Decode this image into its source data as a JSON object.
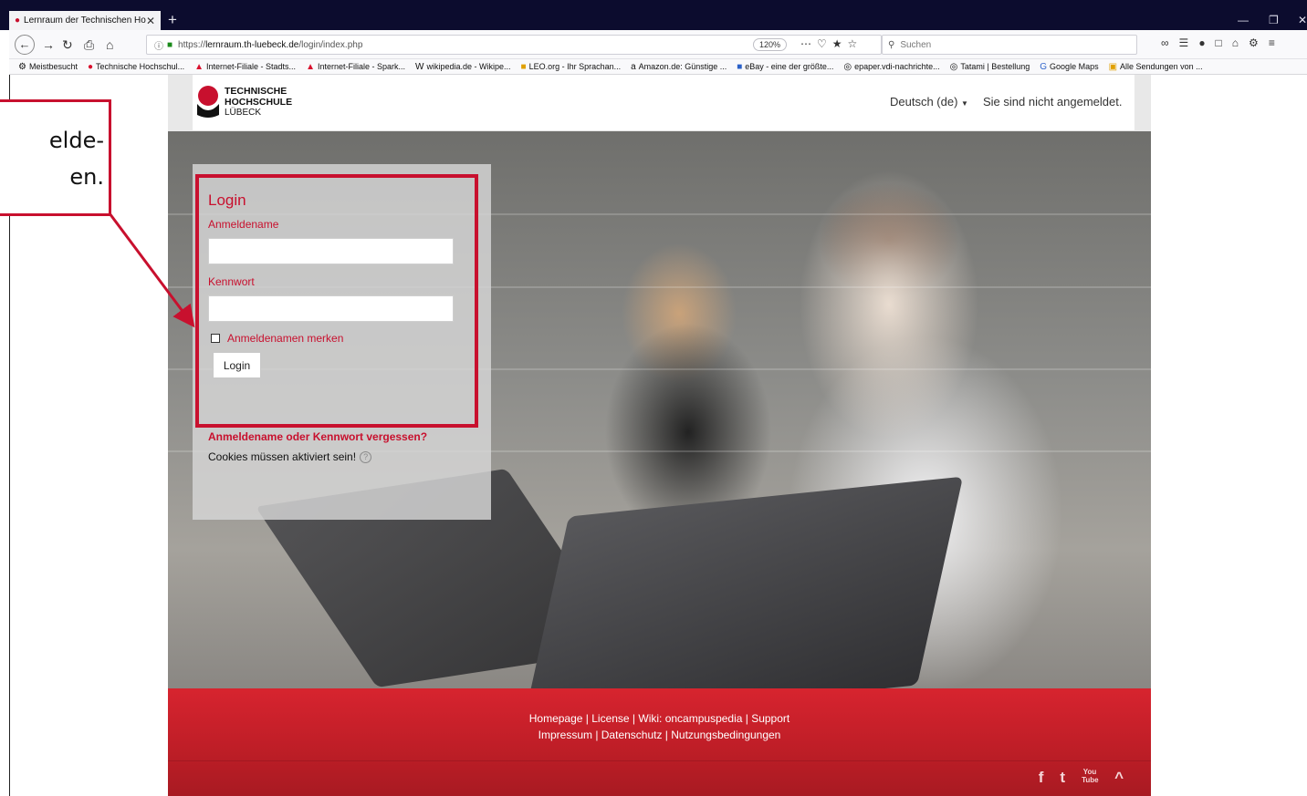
{
  "browser": {
    "tab_title": "Lernraum der Technischen Ho",
    "url_prefix": "https://",
    "url_host": "lernraum.th-luebeck.de",
    "url_path": "/login/index.php",
    "zoom": "120%",
    "search_placeholder": "Suchen",
    "bookmarks": [
      "Meistbesucht",
      "Technische Hochschul...",
      "Internet-Filiale - Stadts...",
      "Internet-Filiale - Spark...",
      "wikipedia.de - Wikipe...",
      "LEO.org - Ihr Sprachan...",
      "Amazon.de: Günstige ...",
      "eBay - eine der größte...",
      "epaper.vdi-nachrichte...",
      "Tatami | Bestellung",
      "Google Maps",
      "Alle Sendungen von ..."
    ]
  },
  "header": {
    "logo_line1": "TECHNISCHE",
    "logo_line2": "HOCHSCHULE",
    "logo_line3": "LÜBECK",
    "language": "Deutsch (de)",
    "login_status": "Sie sind nicht angemeldet."
  },
  "login": {
    "title": "Login",
    "username_label": "Anmeldename",
    "username_value": "",
    "password_label": "Kennwort",
    "password_value": "",
    "remember_label": "Anmeldenamen merken",
    "button_label": "Login",
    "forgot_link": "Anmeldename oder Kennwort vergessen?",
    "cookies_note": "Cookies müssen aktiviert sein!"
  },
  "footer": {
    "links_line1": "Homepage | License | Wiki: oncampuspedia | Support",
    "links_line2": "Impressum | Datenschutz | Nutzungsbedingungen",
    "social": [
      "f",
      "t",
      "You Tube",
      "^"
    ]
  },
  "annotation": {
    "line1": "elde-",
    "line2": "en."
  },
  "colors": {
    "brand_red": "#c8102e",
    "footer_red": "#d7242f"
  }
}
